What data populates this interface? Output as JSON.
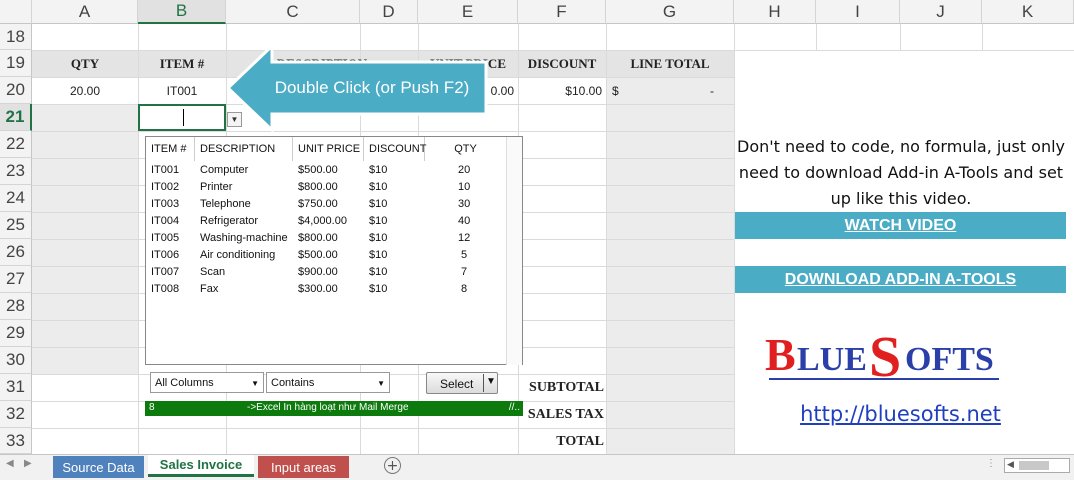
{
  "columns": [
    "A",
    "B",
    "C",
    "D",
    "E",
    "F",
    "G",
    "H",
    "I",
    "J",
    "K"
  ],
  "rows": [
    "18",
    "19",
    "20",
    "21",
    "22",
    "23",
    "24",
    "25",
    "26",
    "27",
    "28",
    "29",
    "30",
    "31",
    "32",
    "33"
  ],
  "invoice": {
    "headers": {
      "qty": "QTY",
      "item": "ITEM #",
      "desc": "DESCRIPTION",
      "unit": "UNIT PRICE",
      "discount": "DISCOUNT",
      "total": "LINE TOTAL"
    },
    "row20": {
      "qty": "20.00",
      "item": "IT001",
      "unit": "0.00",
      "discount": "$10.00",
      "currency": "$",
      "total": "-"
    },
    "totals": {
      "subtotal": "SUBTOTAL",
      "tax": "SALES TAX",
      "total": "TOTAL"
    }
  },
  "callout": {
    "text": "Double Click (or Push F2)",
    "color": "#4bacc6"
  },
  "popup": {
    "headers": [
      "ITEM #",
      "DESCRIPTION",
      "UNIT PRICE",
      "DISCOUNT",
      "QTY"
    ],
    "items": [
      [
        "IT001",
        "Computer",
        "$500.00",
        "$10",
        "20"
      ],
      [
        "IT002",
        "Printer",
        "$800.00",
        "$10",
        "10"
      ],
      [
        "IT003",
        "Telephone",
        "$750.00",
        "$10",
        "30"
      ],
      [
        "IT004",
        "Refrigerator",
        "$4,000.00",
        "$10",
        "40"
      ],
      [
        "IT005",
        "Washing-machine",
        "$800.00",
        "$10",
        "12"
      ],
      [
        "IT006",
        "Air conditioning",
        "$500.00",
        "$10",
        "5"
      ],
      [
        "IT007",
        "Scan",
        "$900.00",
        "$10",
        "7"
      ],
      [
        "IT008",
        "Fax",
        "$300.00",
        "$10",
        "8"
      ]
    ],
    "column_filter": "All Columns",
    "match_mode": "Contains",
    "select_label": "Select",
    "status_count": "8",
    "status_text": "->Excel In hàng loạt như Mail Merge",
    "status_grip": "//.."
  },
  "side": {
    "text": "Don't need to code, no formula, just only need to download Add-in A-Tools and set up like this video.",
    "watch": "WATCH VIDEO",
    "download": "DOWNLOAD ADD-IN A-TOOLS",
    "logo": "BLUESOFTS",
    "url": "http://bluesofts.net"
  },
  "tabs": [
    {
      "label": "Source Data",
      "color": "#4f81bd"
    },
    {
      "label": "Sales Invoice",
      "active": true
    },
    {
      "label": "Input areas",
      "color": "#c0504d"
    }
  ]
}
